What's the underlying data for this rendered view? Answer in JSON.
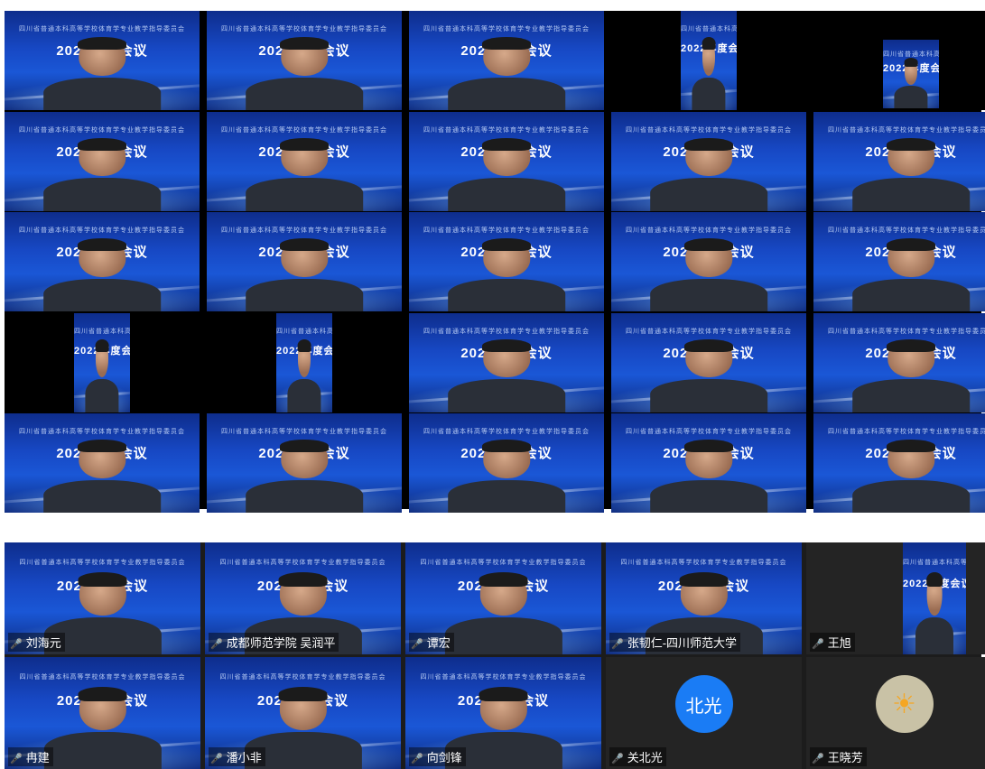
{
  "tile_text": {
    "meeting": "2022年度会议",
    "banner": "四川省普通本科高等学校体育学专业教学指导委员会"
  },
  "top_panel": {
    "tiles": [
      {
        "layout": "full"
      },
      {
        "layout": "full"
      },
      {
        "layout": "full"
      },
      {
        "layout": "narrow"
      },
      {
        "layout": "small"
      },
      {
        "layout": "full"
      },
      {
        "layout": "full"
      },
      {
        "layout": "full"
      },
      {
        "layout": "full"
      },
      {
        "layout": "full"
      },
      {
        "layout": "full"
      },
      {
        "layout": "full"
      },
      {
        "layout": "full"
      },
      {
        "layout": "full"
      },
      {
        "layout": "full"
      },
      {
        "layout": "narrow"
      },
      {
        "layout": "narrow"
      },
      {
        "layout": "full"
      },
      {
        "layout": "full"
      },
      {
        "layout": "full"
      },
      {
        "layout": "full"
      },
      {
        "layout": "full"
      },
      {
        "layout": "full"
      },
      {
        "layout": "full"
      },
      {
        "layout": "full"
      }
    ]
  },
  "bottom_panel": {
    "participants": [
      {
        "name": "刘海元",
        "video": "full"
      },
      {
        "name": "成都师范学院 吴润平",
        "video": "full"
      },
      {
        "name": "谭宏",
        "video": "full"
      },
      {
        "name": "张韧仁-四川师范大学",
        "video": "full"
      },
      {
        "name": "王旭",
        "video": "narrow"
      },
      {
        "name": "冉建",
        "video": "full"
      },
      {
        "name": "潘小非",
        "video": "full"
      },
      {
        "name": "向剑锋",
        "video": "full"
      },
      {
        "name": "关北光",
        "video": "avatar",
        "avatar_text": "北光",
        "avatar_style": "blue"
      },
      {
        "name": "王晓芳",
        "video": "avatar",
        "avatar_text": "☀",
        "avatar_style": "sun"
      }
    ]
  },
  "colors": {
    "tile_blue": "#1748c4",
    "avatar_blue": "#1a7cf5",
    "mic": "#ff7a6a"
  }
}
